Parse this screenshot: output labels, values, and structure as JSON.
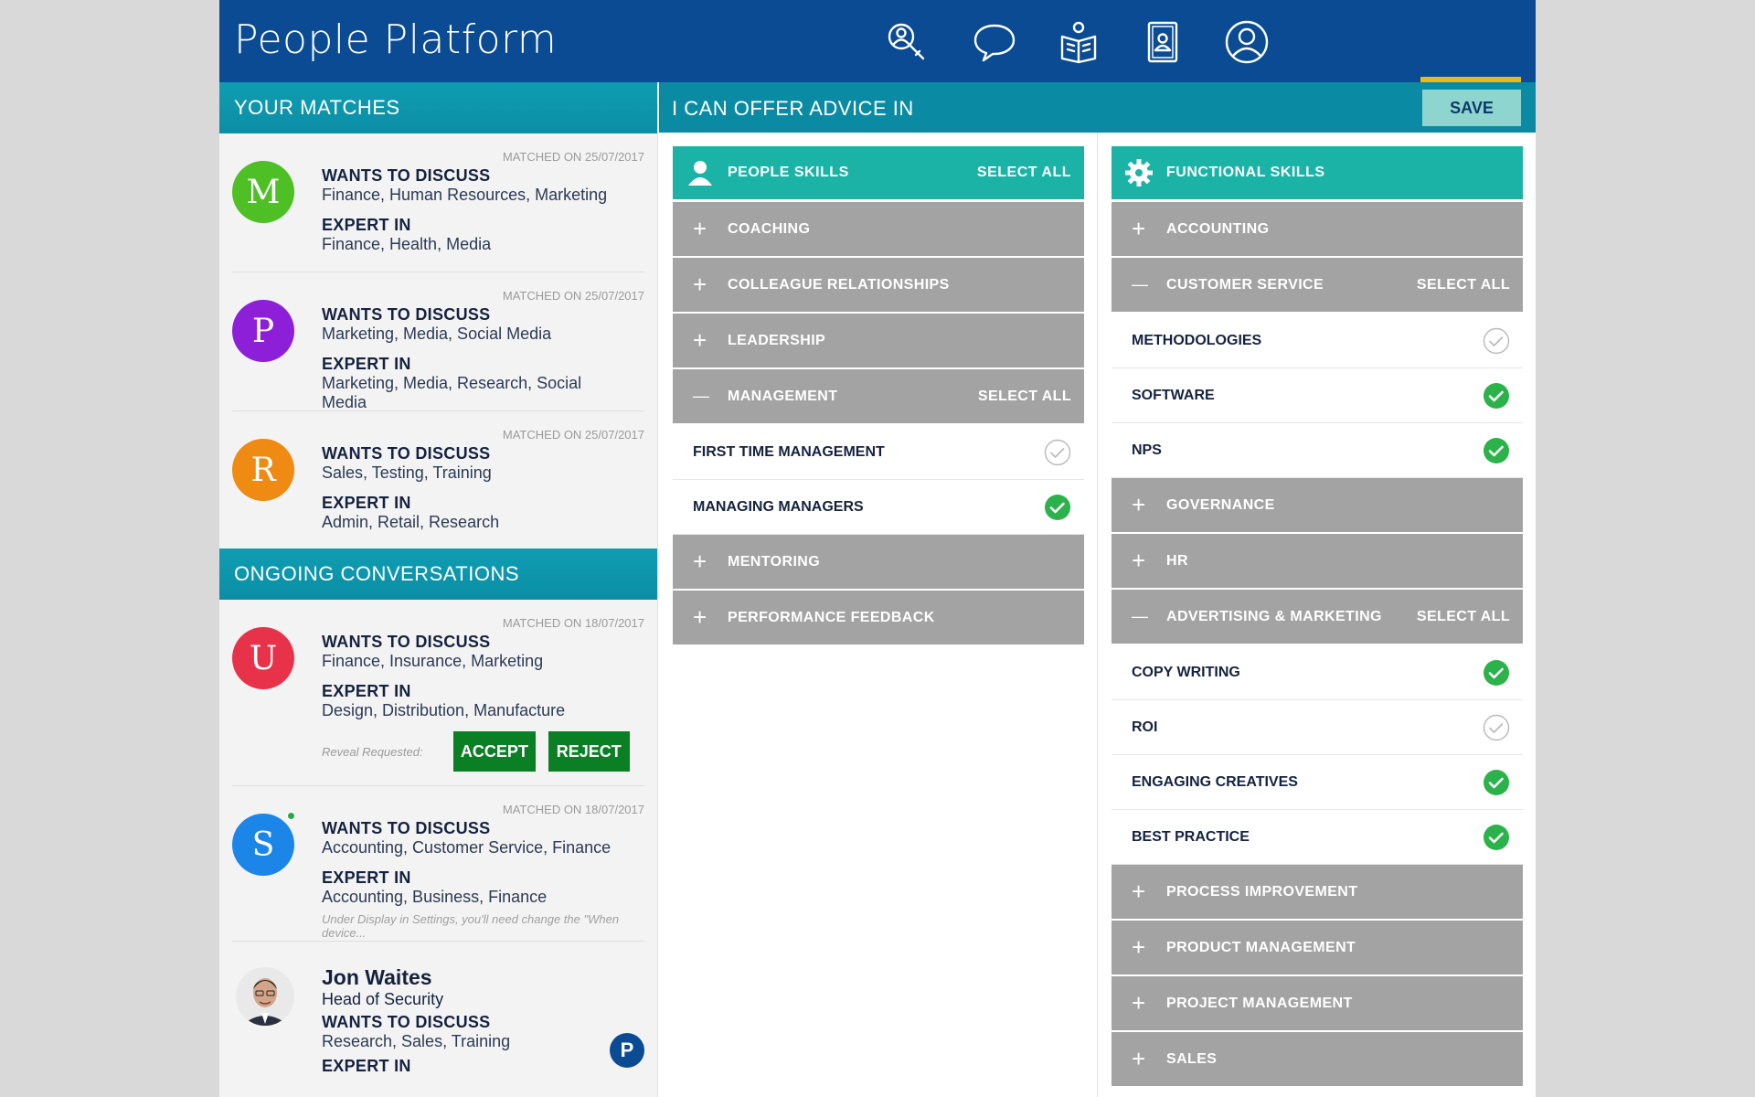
{
  "brand": "People Platform",
  "nav": [
    {
      "icon": "search-profile-icon"
    },
    {
      "icon": "chat-icon"
    },
    {
      "icon": "reading-icon"
    },
    {
      "icon": "contacts-book-icon"
    },
    {
      "icon": "profile-icon",
      "active": true
    }
  ],
  "colors": {
    "header": "#0a4b93",
    "teal": "#0a8ba3",
    "category": "#1ab3a6",
    "group": "#a3a3a3",
    "accept": "#0b7f24",
    "check": "#2cb24a",
    "underline": "#e8b81a"
  },
  "matches": {
    "title": "YOUR MATCHES",
    "items": [
      {
        "initial": "M",
        "color": "#4fbf26",
        "date": "MATCHED ON 25/07/2017",
        "wants_label": "WANTS TO DISCUSS",
        "wants": "Finance, Human Resources, Marketing",
        "expert_label": "EXPERT IN",
        "expert": "Finance, Health, Media"
      },
      {
        "initial": "P",
        "color": "#8e1fd9",
        "date": "MATCHED ON 25/07/2017",
        "wants_label": "WANTS TO DISCUSS",
        "wants": "Marketing, Media, Social Media",
        "expert_label": "EXPERT IN",
        "expert": "Marketing, Media, Research, Social Media"
      },
      {
        "initial": "R",
        "color": "#ef8a12",
        "date": "MATCHED ON 25/07/2017",
        "wants_label": "WANTS TO DISCUSS",
        "wants": "Sales, Testing, Training",
        "expert_label": "EXPERT IN",
        "expert": "Admin, Retail, Research"
      }
    ]
  },
  "conversations": {
    "title": "ONGOING CONVERSATIONS",
    "items": [
      {
        "initial": "U",
        "color": "#e8324a",
        "date": "MATCHED ON 18/07/2017",
        "wants_label": "WANTS TO DISCUSS",
        "wants": "Finance, Insurance, Marketing",
        "expert_label": "EXPERT IN",
        "expert": "Design, Distribution, Manufacture",
        "reveal": "Reveal Requested:",
        "accept": "ACCEPT",
        "reject": "REJECT"
      },
      {
        "initial": "S",
        "color": "#1c86e8",
        "date": "MATCHED ON 18/07/2017",
        "wants_label": "WANTS TO DISCUSS",
        "wants": "Accounting, Customer Service, Finance",
        "expert_label": "EXPERT IN",
        "expert": "Accounting, Business, Finance",
        "note": "Under Display in Settings, you'll need change the \"When device..."
      }
    ],
    "person": {
      "name": "Jon Waites",
      "role": "Head of Security",
      "wants_label": "WANTS TO DISCUSS",
      "wants": "Research, Sales, Training",
      "expert_label": "EXPERT IN",
      "badge": "P"
    }
  },
  "advice": {
    "title": "I CAN OFFER ADVICE IN",
    "save": "SAVE",
    "people": {
      "icon": "person-icon",
      "title": "PEOPLE SKILLS",
      "select_all": "SELECT ALL",
      "rows": [
        {
          "kind": "group",
          "label": "COACHING",
          "expanded": false
        },
        {
          "kind": "group",
          "label": "COLLEAGUE RELATIONSHIPS",
          "expanded": false
        },
        {
          "kind": "group",
          "label": "LEADERSHIP",
          "expanded": false
        },
        {
          "kind": "group",
          "label": "MANAGEMENT",
          "expanded": true,
          "select_all": "SELECT ALL"
        },
        {
          "kind": "item",
          "label": "FIRST TIME MANAGEMENT",
          "checked": false
        },
        {
          "kind": "item",
          "label": "MANAGING MANAGERS",
          "checked": true
        },
        {
          "kind": "group",
          "label": "MENTORING",
          "expanded": false
        },
        {
          "kind": "group",
          "label": "PERFORMANCE FEEDBACK",
          "expanded": false
        }
      ]
    },
    "functional": {
      "icon": "gear-icon",
      "title": "FUNCTIONAL SKILLS",
      "rows": [
        {
          "kind": "group",
          "label": "ACCOUNTING",
          "expanded": false
        },
        {
          "kind": "group",
          "label": "CUSTOMER SERVICE",
          "expanded": true,
          "select_all": "SELECT ALL"
        },
        {
          "kind": "item",
          "label": "METHODOLOGIES",
          "checked": false
        },
        {
          "kind": "item",
          "label": "SOFTWARE",
          "checked": true
        },
        {
          "kind": "item",
          "label": "NPS",
          "checked": true
        },
        {
          "kind": "group",
          "label": "GOVERNANCE",
          "expanded": false
        },
        {
          "kind": "group",
          "label": "HR",
          "expanded": false
        },
        {
          "kind": "group",
          "label": "ADVERTISING & MARKETING",
          "expanded": true,
          "select_all": "SELECT ALL"
        },
        {
          "kind": "item",
          "label": "COPY WRITING",
          "checked": true
        },
        {
          "kind": "item",
          "label": "ROI",
          "checked": false
        },
        {
          "kind": "item",
          "label": "ENGAGING CREATIVES",
          "checked": true
        },
        {
          "kind": "item",
          "label": "BEST PRACTICE",
          "checked": true
        },
        {
          "kind": "group",
          "label": "PROCESS IMPROVEMENT",
          "expanded": false
        },
        {
          "kind": "group",
          "label": "PRODUCT MANAGEMENT",
          "expanded": false
        },
        {
          "kind": "group",
          "label": "PROJECT MANAGEMENT",
          "expanded": false
        },
        {
          "kind": "group",
          "label": "SALES",
          "expanded": false
        }
      ]
    }
  }
}
